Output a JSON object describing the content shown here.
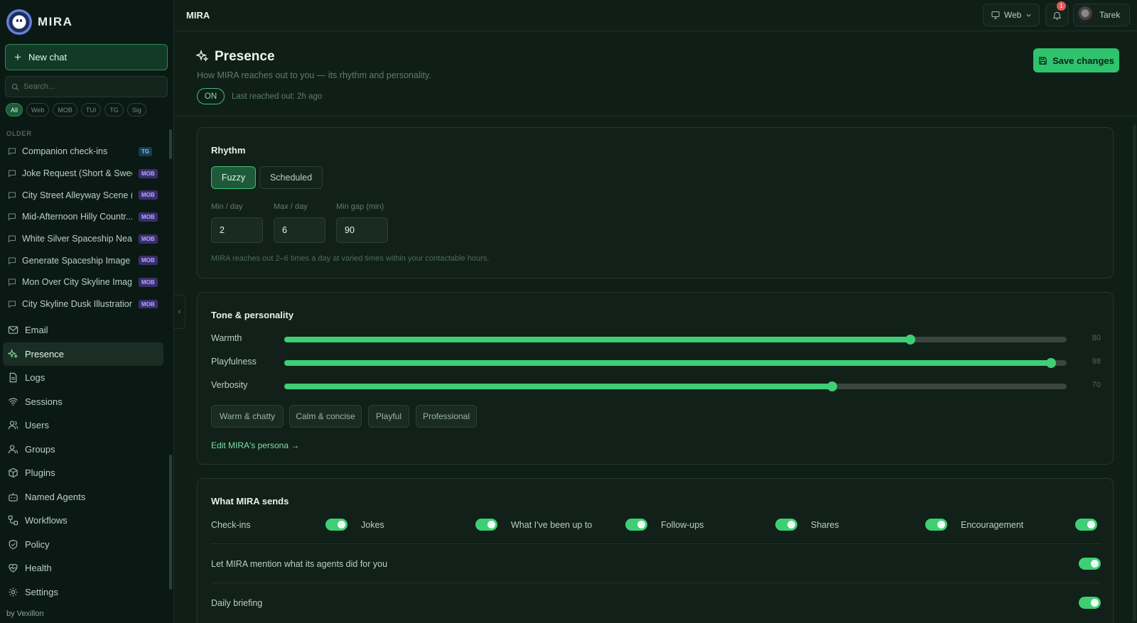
{
  "brand": {
    "name": "MIRA"
  },
  "sidebar": {
    "new_chat": "New chat",
    "search_placeholder": "Search...",
    "filters": [
      "All",
      "Web",
      "MOB",
      "TUI",
      "TG",
      "Sig"
    ],
    "section_label": "OLDER",
    "chats": [
      {
        "title": "Companion check-ins",
        "badge": "TG"
      },
      {
        "title": "Joke Request (Short & Sweet)",
        "badge": "MOB"
      },
      {
        "title": "City Street Alleyway Scene (...",
        "badge": "MOB"
      },
      {
        "title": "Mid-Afternoon Hilly Countr...",
        "badge": "MOB"
      },
      {
        "title": "White Silver Spaceship Near...",
        "badge": "MOB"
      },
      {
        "title": "Generate Spaceship Image i...",
        "badge": "MOB"
      },
      {
        "title": "Mon Over City Skyline Imag...",
        "badge": "MOB"
      },
      {
        "title": "City Skyline Dusk Illustration",
        "badge": "MOB"
      }
    ],
    "nav": [
      {
        "label": "Email",
        "icon": "mail-icon"
      },
      {
        "label": "Presence",
        "icon": "sparkle-icon",
        "active": true
      },
      {
        "label": "Logs",
        "icon": "document-icon"
      },
      {
        "label": "Sessions",
        "icon": "wifi-icon"
      },
      {
        "label": "Users",
        "icon": "user-icon"
      },
      {
        "label": "Groups",
        "icon": "users-icon"
      },
      {
        "label": "Plugins",
        "icon": "package-icon"
      },
      {
        "label": "Named Agents",
        "icon": "bot-icon"
      },
      {
        "label": "Workflows",
        "icon": "workflow-icon"
      },
      {
        "label": "Policy",
        "icon": "shield-icon"
      },
      {
        "label": "Health",
        "icon": "heart-pulse-icon"
      },
      {
        "label": "Settings",
        "icon": "gear-icon"
      }
    ],
    "footer": "by Vexillon"
  },
  "topbar": {
    "title": "MIRA",
    "platform": "Web",
    "notifications": "1",
    "user": "Tarek"
  },
  "page": {
    "title": "Presence",
    "subtitle": "How MIRA reaches out to you — its rhythm and personality.",
    "status": "ON",
    "last_reached": "Last reached out: 2h ago",
    "save_label": "Save changes"
  },
  "rhythm": {
    "title": "Rhythm",
    "modes": [
      "Fuzzy",
      "Scheduled"
    ],
    "active_mode": "Fuzzy",
    "fields": [
      {
        "label": "Min / day",
        "value": "2"
      },
      {
        "label": "Max / day",
        "value": "6"
      },
      {
        "label": "Min gap (min)",
        "value": "90"
      }
    ],
    "hint": "MIRA reaches out 2–6 times a day at varied times within your contactable hours."
  },
  "tone": {
    "title": "Tone & personality",
    "sliders": [
      {
        "label": "Warmth",
        "value": 80,
        "display": "80"
      },
      {
        "label": "Playfulness",
        "value": 98,
        "display": "98"
      },
      {
        "label": "Verbosity",
        "value": 70,
        "display": "70"
      }
    ],
    "presets": [
      "Warm & chatty",
      "Calm & concise",
      "Playful",
      "Professional"
    ],
    "persona_link": "Edit MIRA's persona →"
  },
  "sends": {
    "title": "What MIRA sends",
    "toggles": [
      {
        "label": "Check-ins",
        "on": true
      },
      {
        "label": "Jokes",
        "on": true
      },
      {
        "label": "What I've been up to",
        "on": true
      },
      {
        "label": "Follow-ups",
        "on": true
      },
      {
        "label": "Shares",
        "on": true
      },
      {
        "label": "Encouragement",
        "on": true
      }
    ],
    "agents_mention": {
      "label": "Let MIRA mention what its agents did for you",
      "on": true
    },
    "daily_briefing": {
      "label": "Daily briefing",
      "on": true
    }
  },
  "colors": {
    "accent": "#3ecf74",
    "background": "#0f1f18",
    "mob_badge": "#3a2f6e",
    "tg_badge": "#163c55"
  }
}
